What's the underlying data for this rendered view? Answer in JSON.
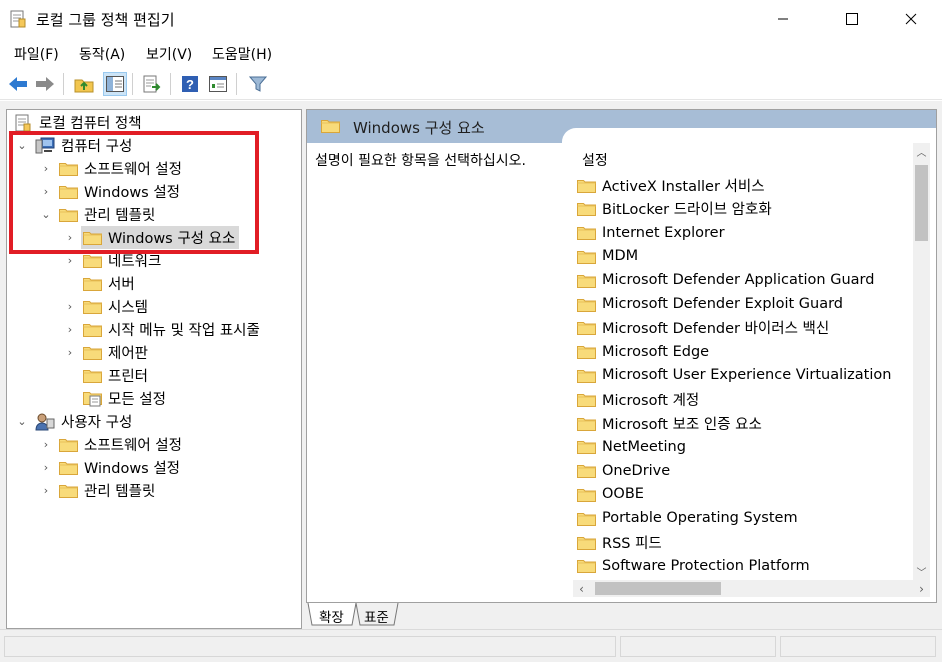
{
  "window": {
    "title": "로컬 그룹 정책 편집기",
    "icons": {
      "app": "gpedit-icon",
      "minimize": "minimize-icon",
      "maximize": "maximize-icon",
      "close": "close-icon"
    }
  },
  "menu": [
    "파일(F)",
    "동작(A)",
    "보기(V)",
    "도움말(H)"
  ],
  "toolbar": [
    "back-icon",
    "forward-icon",
    "up-folder-icon",
    "show-hide-tree-icon",
    "export-list-icon",
    "help-icon",
    "properties-icon",
    "filter-icon"
  ],
  "tree": {
    "root": "로컬 컴퓨터 정책",
    "computer_config": "컴퓨터 구성",
    "cc_software": "소프트웨어 설정",
    "cc_windows": "Windows 설정",
    "cc_admin": "관리 템플릿",
    "cc_windows_components": "Windows 구성 요소",
    "cc_network": "네트워크",
    "cc_server": "서버",
    "cc_system": "시스템",
    "cc_start_menu": "시작 메뉴 및 작업 표시줄",
    "cc_control_panel": "제어판",
    "cc_printers": "프린터",
    "cc_all_settings": "모든 설정",
    "user_config": "사용자 구성",
    "uc_software": "소프트웨어 설정",
    "uc_windows": "Windows 설정",
    "uc_admin": "관리 템플릿"
  },
  "right_pane": {
    "header": "Windows 구성 요소",
    "description": "설명이 필요한 항목을 선택하십시오.",
    "column": "설정",
    "items": [
      "ActiveX Installer 서비스",
      "BitLocker 드라이브 암호화",
      "Internet Explorer",
      "MDM",
      "Microsoft Defender Application Guard",
      "Microsoft Defender Exploit Guard",
      "Microsoft Defender 바이러스 백신",
      "Microsoft Edge",
      "Microsoft User Experience Virtualization",
      "Microsoft 계정",
      "Microsoft 보조 인증 요소",
      "NetMeeting",
      "OneDrive",
      "OOBE",
      "Portable Operating System",
      "RSS 피드",
      "Software Protection Platform"
    ]
  },
  "tabs": {
    "extended": "확장",
    "standard": "표준"
  },
  "colors": {
    "highlight": "#e11d25",
    "header_bg": "#a7bdd6",
    "selection_bg": "#d9d9d9",
    "folder": "#f5d374"
  }
}
